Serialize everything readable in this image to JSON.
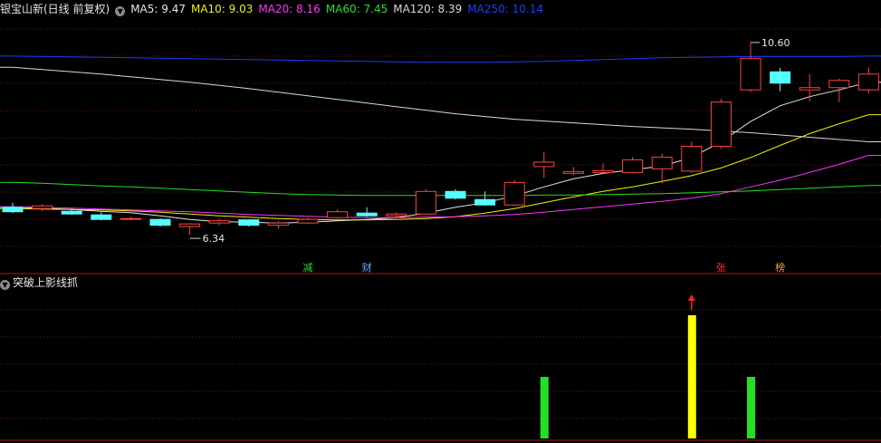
{
  "header": {
    "title": "银宝山新(日线 前复权)",
    "ma": [
      {
        "key": "ma5",
        "label": "MA5: 9.47",
        "color": "#e6e6e6"
      },
      {
        "key": "ma10",
        "label": "MA10: 9.03",
        "color": "#f0f000"
      },
      {
        "key": "ma20",
        "label": "MA20: 8.16",
        "color": "#ff33ff"
      },
      {
        "key": "ma60",
        "label": "MA60: 7.45",
        "color": "#22e022"
      },
      {
        "key": "ma120",
        "label": "MA120: 8.39",
        "color": "#d8d8d8"
      },
      {
        "key": "ma250",
        "label": "MA250: 10.14",
        "color": "#1a3cff"
      }
    ]
  },
  "sub_panel": {
    "title": "突破上影线抓"
  },
  "annotations": {
    "high_label": "10.60",
    "low_label": "6.34",
    "markers": [
      {
        "text": "减",
        "color": "#22e022",
        "bar": 10
      },
      {
        "text": "财",
        "color": "#66aaff",
        "bar": 12
      },
      {
        "text": "张",
        "color": "#ff3030",
        "bar": 24
      },
      {
        "text": "榜",
        "color": "#ff9933",
        "bar": 26
      }
    ]
  },
  "chart_data": [
    {
      "type": "candlestick",
      "title": "银宝山新(日线 前复权)",
      "ylim": [
        5.6,
        11.1
      ],
      "candles": [
        {
          "o": 6.95,
          "h": 7.05,
          "l": 6.82,
          "c": 6.85
        },
        {
          "o": 6.92,
          "h": 7.02,
          "l": 6.86,
          "c": 6.98
        },
        {
          "o": 6.86,
          "h": 6.92,
          "l": 6.78,
          "c": 6.8
        },
        {
          "o": 6.78,
          "h": 6.84,
          "l": 6.66,
          "c": 6.68
        },
        {
          "o": 6.7,
          "h": 6.74,
          "l": 6.66,
          "c": 6.7
        },
        {
          "o": 6.68,
          "h": 6.7,
          "l": 6.52,
          "c": 6.55
        },
        {
          "o": 6.52,
          "h": 6.6,
          "l": 6.34,
          "c": 6.58
        },
        {
          "o": 6.6,
          "h": 6.7,
          "l": 6.55,
          "c": 6.65
        },
        {
          "o": 6.67,
          "h": 6.68,
          "l": 6.52,
          "c": 6.55
        },
        {
          "o": 6.55,
          "h": 6.64,
          "l": 6.48,
          "c": 6.6
        },
        {
          "o": 6.6,
          "h": 6.72,
          "l": 6.58,
          "c": 6.68
        },
        {
          "o": 6.72,
          "h": 6.9,
          "l": 6.7,
          "c": 6.85
        },
        {
          "o": 6.82,
          "h": 6.95,
          "l": 6.74,
          "c": 6.76
        },
        {
          "o": 6.76,
          "h": 6.84,
          "l": 6.7,
          "c": 6.8
        },
        {
          "o": 6.8,
          "h": 7.35,
          "l": 6.78,
          "c": 7.3
        },
        {
          "o": 7.3,
          "h": 7.35,
          "l": 7.12,
          "c": 7.15
        },
        {
          "o": 7.12,
          "h": 7.3,
          "l": 6.98,
          "c": 7.0
        },
        {
          "o": 7.0,
          "h": 7.55,
          "l": 6.98,
          "c": 7.5
        },
        {
          "o": 7.85,
          "h": 8.18,
          "l": 7.6,
          "c": 7.95
        },
        {
          "o": 7.7,
          "h": 7.84,
          "l": 7.66,
          "c": 7.74
        },
        {
          "o": 7.72,
          "h": 7.92,
          "l": 7.7,
          "c": 7.76
        },
        {
          "o": 7.72,
          "h": 8.06,
          "l": 7.7,
          "c": 8.0
        },
        {
          "o": 7.8,
          "h": 8.14,
          "l": 7.48,
          "c": 8.06
        },
        {
          "o": 7.75,
          "h": 8.4,
          "l": 7.72,
          "c": 8.3
        },
        {
          "o": 8.3,
          "h": 9.35,
          "l": 8.24,
          "c": 9.28
        },
        {
          "o": 9.55,
          "h": 10.6,
          "l": 9.5,
          "c": 10.25
        },
        {
          "o": 9.95,
          "h": 10.04,
          "l": 9.52,
          "c": 9.7
        },
        {
          "o": 9.55,
          "h": 9.9,
          "l": 9.3,
          "c": 9.6
        },
        {
          "o": 9.6,
          "h": 9.8,
          "l": 9.28,
          "c": 9.76
        },
        {
          "o": 9.55,
          "h": 10.05,
          "l": 9.48,
          "c": 9.9
        }
      ],
      "series": [
        {
          "name": "MA5",
          "color": "#e6e6e6",
          "values": [
            6.95,
            6.93,
            6.9,
            6.86,
            6.83,
            6.76,
            6.68,
            6.63,
            6.62,
            6.6,
            6.62,
            6.65,
            6.68,
            6.72,
            6.82,
            6.95,
            7.05,
            7.2,
            7.4,
            7.58,
            7.7,
            7.78,
            7.86,
            8.05,
            8.4,
            8.85,
            9.2,
            9.4,
            9.55,
            9.72
          ]
        },
        {
          "name": "MA10",
          "color": "#f0f000",
          "values": [
            6.92,
            6.91,
            6.9,
            6.89,
            6.87,
            6.84,
            6.8,
            6.76,
            6.73,
            6.7,
            6.68,
            6.67,
            6.67,
            6.68,
            6.7,
            6.74,
            6.82,
            6.92,
            7.05,
            7.18,
            7.3,
            7.4,
            7.52,
            7.65,
            7.82,
            8.05,
            8.32,
            8.58,
            8.8,
            9.0
          ]
        },
        {
          "name": "MA20",
          "color": "#ff33ff",
          "values": [
            6.96,
            6.95,
            6.93,
            6.91,
            6.89,
            6.87,
            6.85,
            6.82,
            6.79,
            6.77,
            6.75,
            6.73,
            6.72,
            6.72,
            6.73,
            6.74,
            6.76,
            6.79,
            6.84,
            6.9,
            6.96,
            7.02,
            7.08,
            7.15,
            7.25,
            7.4,
            7.55,
            7.72,
            7.9,
            8.1
          ]
        },
        {
          "name": "MA60",
          "color": "#22e022",
          "values": [
            7.5,
            7.48,
            7.45,
            7.42,
            7.4,
            7.37,
            7.34,
            7.31,
            7.28,
            7.25,
            7.23,
            7.22,
            7.21,
            7.21,
            7.21,
            7.21,
            7.21,
            7.21,
            7.22,
            7.22,
            7.23,
            7.24,
            7.25,
            7.27,
            7.29,
            7.31,
            7.34,
            7.37,
            7.4,
            7.43
          ]
        },
        {
          "name": "MA120",
          "color": "#d8d8d8",
          "values": [
            10.05,
            10.0,
            9.95,
            9.9,
            9.84,
            9.78,
            9.72,
            9.65,
            9.58,
            9.5,
            9.42,
            9.34,
            9.26,
            9.18,
            9.1,
            9.02,
            8.96,
            8.9,
            8.86,
            8.82,
            8.78,
            8.74,
            8.71,
            8.68,
            8.64,
            8.6,
            8.55,
            8.5,
            8.45,
            8.4
          ]
        },
        {
          "name": "MA250",
          "color": "#1a3cff",
          "values": [
            10.3,
            10.29,
            10.28,
            10.27,
            10.26,
            10.25,
            10.24,
            10.23,
            10.22,
            10.21,
            10.2,
            10.19,
            10.18,
            10.17,
            10.16,
            10.16,
            10.16,
            10.17,
            10.18,
            10.2,
            10.22,
            10.24,
            10.26,
            10.27,
            10.28,
            10.29,
            10.29,
            10.29,
            10.29,
            10.3
          ]
        }
      ]
    },
    {
      "type": "bar",
      "title": "突破上影线抓",
      "bars": [
        {
          "bar": 18,
          "value": 0.5,
          "color": "#22e022"
        },
        {
          "bar": 23,
          "value": 1.0,
          "color": "#ffff00",
          "arrow": true
        },
        {
          "bar": 25,
          "value": 0.5,
          "color": "#22e022"
        }
      ],
      "ylim": [
        0,
        1.0
      ]
    }
  ]
}
